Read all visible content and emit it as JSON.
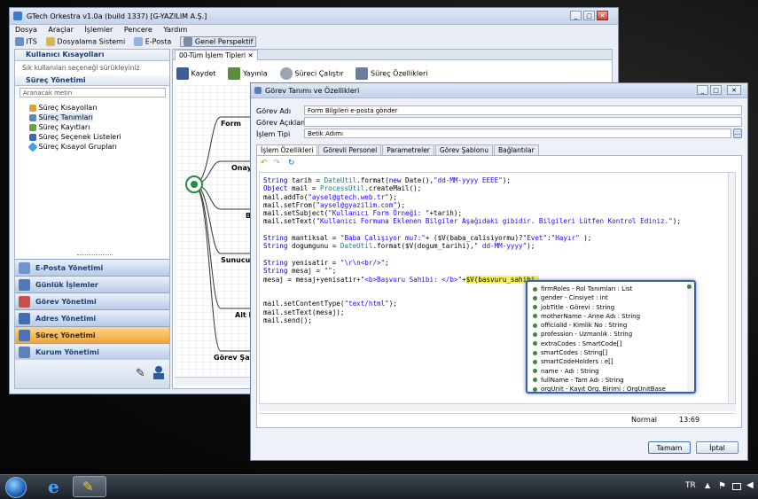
{
  "main_window": {
    "title": "GTech Orkestra v1.0a (build 1337) [G-YAZILIM A.Ş.]",
    "menu": [
      "Dosya",
      "Araçlar",
      "İşlemler",
      "Pencere",
      "Yardım"
    ],
    "toolbar": [
      "ITS",
      "Dosyalama Sistemi",
      "E-Posta",
      "Genel Perspektif"
    ]
  },
  "left_panel": {
    "shortcuts_title": "Kullanıcı Kısayolları",
    "shortcuts_hint": "Sık kullanılan seçeneği sürükleyiniz",
    "process_title": "Süreç Yönetimi",
    "search_placeholder": "Aranacak metin",
    "tree": [
      "Süreç Kısayolları",
      "Süreç Tanımları",
      "Süreç Kayıtları",
      "Süreç Seçenek Listeleri",
      "Süreç Kısayol Grupları"
    ],
    "nav": [
      "E-Posta Yönetimi",
      "Günlük İşlemler",
      "Görev Yönetimi",
      "Adres Yönetimi",
      "Süreç Yönetimi",
      "Kurum Yönetimi"
    ]
  },
  "editor": {
    "tab": "00-Tüm İşlem Tipleri",
    "toolbar": [
      "Kaydet",
      "Yayınla",
      "Süreci Çalıştır",
      "Süreç Özellikleri"
    ],
    "nodes": [
      "Form",
      "Onay Sü",
      "Bet",
      "Sunucu Rap",
      "Alt Rap",
      "Görev Şablonu"
    ]
  },
  "dialog": {
    "title": "Görev Tanımı ve Özellikleri",
    "fields": [
      {
        "label": "Görev Adı",
        "value": "Form Bilgileri e-posta gönder"
      },
      {
        "label": "Görev Açıklaması",
        "value": ""
      },
      {
        "label": "İşlem Tipi",
        "value": "Betik Adımı"
      }
    ],
    "browse_button": "...",
    "tabs": [
      "İşlem Özellikleri",
      "Görevli Personel",
      "Parametreler",
      "Görev Şablonu",
      "Bağlantılar"
    ],
    "code_lines": [
      "String tarih = DateUtil.format(new Date(),\"dd-MM-yyyy EEEE\");",
      "Object mail = ProcessUtil.createMail();",
      "mail.addTo(\"aysel@gtech.web.tr\");",
      "mail.setFrom(\"aysel@gyazilim.com\");",
      "mail.setSubject(\"Kullanıcı Form Örneği: \"+tarih);",
      "mail.setText(\"Kullanıcı Formuna Eklenen Bilgiler Aşağıdaki gibidir. Bilgileri Lütfen Kontrol Ediniz.\");",
      "",
      "String mantiksal = \"Baba Çalışıyor mu?:\"+ ($V(baba_calisiyormu)?\"Evet\":\"Hayır\" );",
      "String dogumgunu = DateUtil.format($V(dogum_tarihi),\" dd-MM-yyyy\");",
      "",
      "String yenisatir = \"\\r\\n<br/>\";",
      "String mesaj = \"\";",
      "mesaj = mesaj+yenisatir+\"<b>Başvuru Sahibi: </b>\"+",
      "",
      "",
      "mail.setContentType(\"text/html\");",
      "mail.setText(mesaj);",
      "mail.send();"
    ],
    "highlight_text": "$V(basvuru_sahibi.",
    "autocomplete": [
      "firmRoles - Rol Tanımları : List",
      "gender - Cinsiyet : int",
      "jobTitle - Görevi : String",
      "motherName - Anne Adı : String",
      "officialId - Kimlik No : String",
      "profession - Uzmanlık : String",
      "extraCodes : SmartCode[]",
      "smartCodes : String[]",
      "smartCodeHolders : e[]",
      "name - Adı : String",
      "fullName - Tam Adı : String",
      "orgUnit - Kayıt Org. Birimi : OrgUnitBase"
    ],
    "status_mode": "Normal",
    "status_pos": "13:69",
    "ok_button": "Tamam",
    "cancel_button": "İptal"
  },
  "taskbar": {
    "lang": "TR"
  }
}
